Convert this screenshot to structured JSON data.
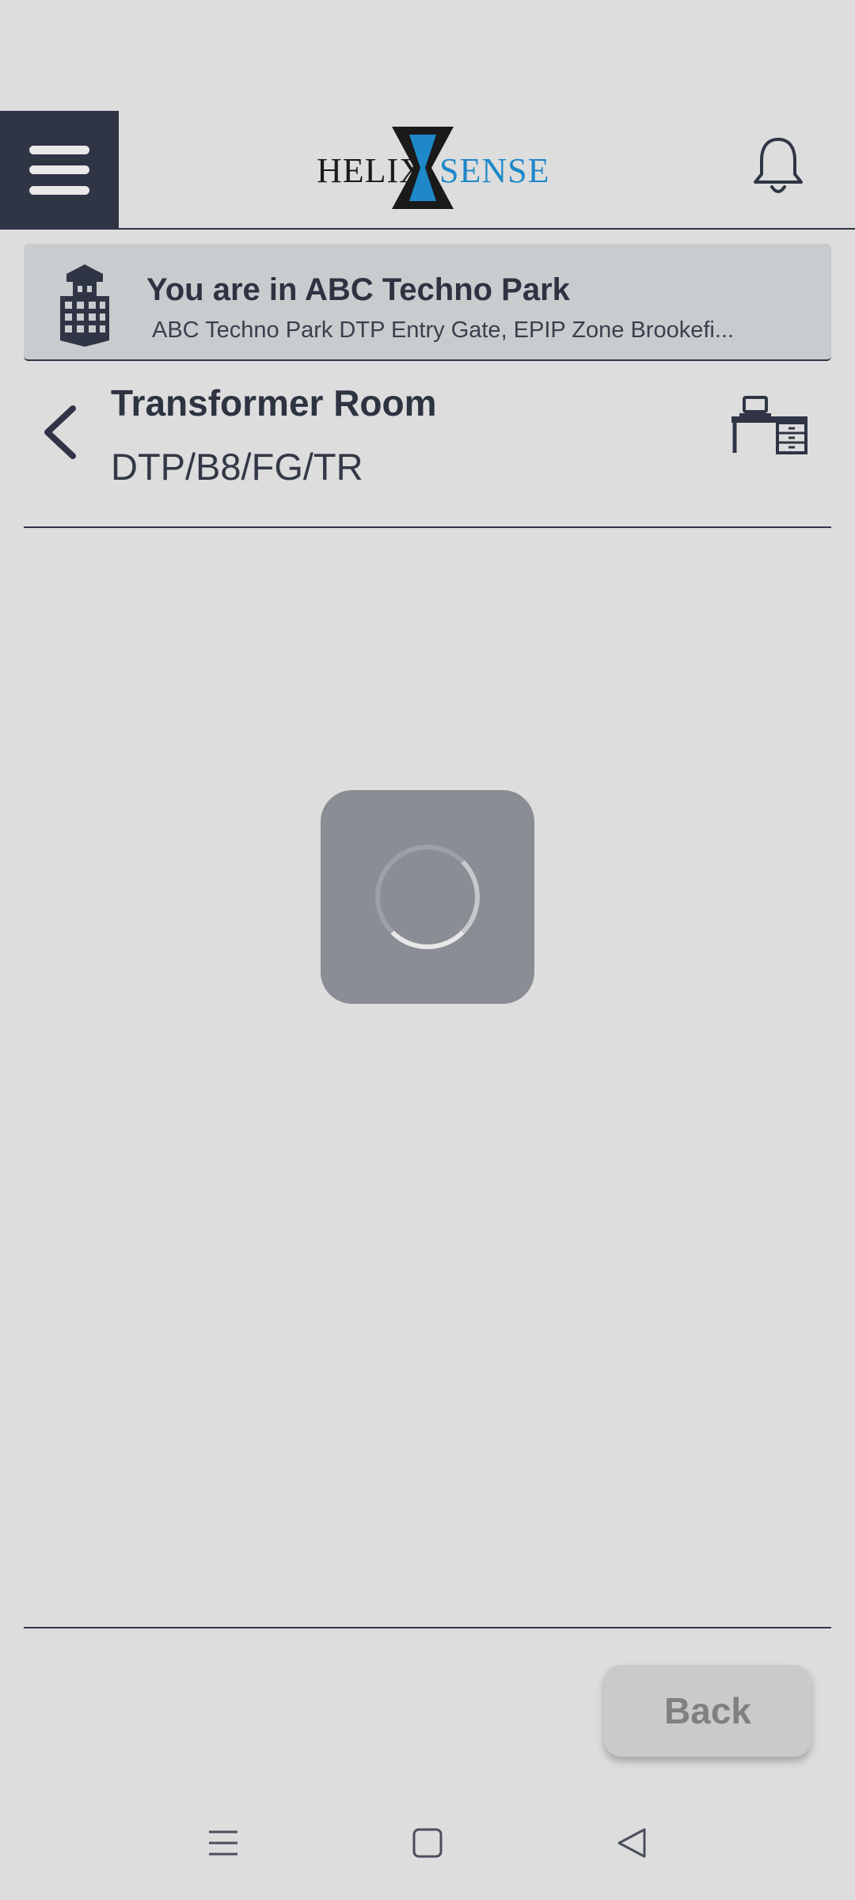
{
  "header": {
    "logo_left": "HELIX",
    "logo_right": "SENSE",
    "icons": [
      "menu-icon",
      "bell-icon"
    ]
  },
  "location": {
    "title": "You are in ABC Techno Park",
    "subtitle": "ABC Techno Park DTP Entry Gate, EPIP Zone Brookefi..."
  },
  "room": {
    "title": "Transformer Room",
    "code": "DTP/B8/FG/TR"
  },
  "footer": {
    "back_label": "Back"
  },
  "colors": {
    "dark": "#2f3545",
    "accent": "#1e88c8",
    "background": "#dddddd"
  }
}
